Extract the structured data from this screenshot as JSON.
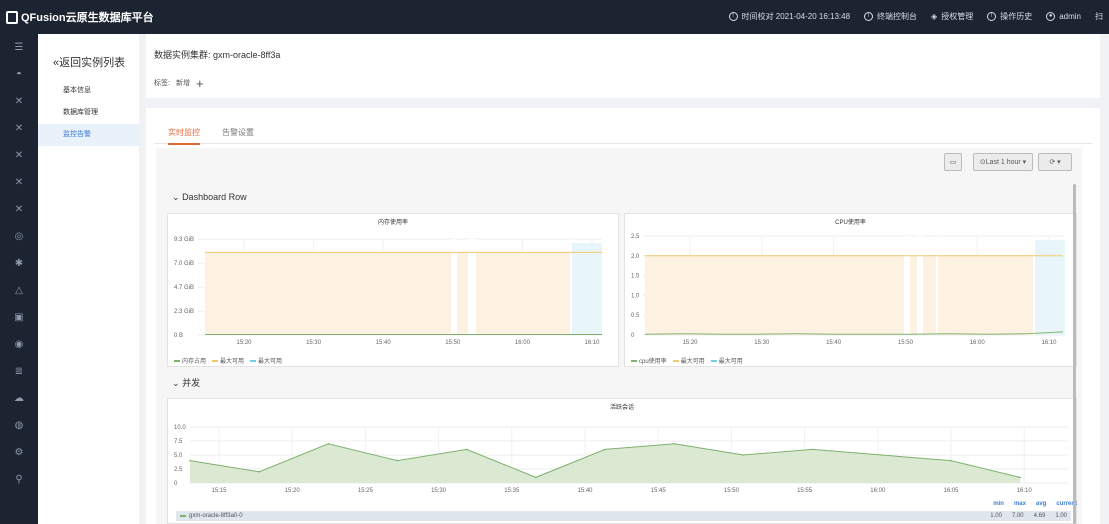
{
  "topbar": {
    "app_name": "QFusion云原生数据库平台",
    "time_check": "时间校对 2021-04-20 16:13:48",
    "terminal": "终端控制台",
    "license": "授权管理",
    "history": "操作历史",
    "user": "admin",
    "extra": "扫"
  },
  "subnav": {
    "back": "«返回实例列表",
    "items": [
      "基本信息",
      "数据库管理",
      "监控告警"
    ]
  },
  "header": {
    "title": "数据实例集群: gxm-oracle-8ff3a",
    "tags_label": "标签:",
    "tag_new": "新增",
    "tag_add": "+"
  },
  "tabs": [
    "实时监控",
    "告警设置"
  ],
  "toolbar": {
    "time_range": "Last 1 hour",
    "dropdown": "▾",
    "refresh": "⟳"
  },
  "rows": {
    "dashboard": "Dashboard Row",
    "concurrency": "并发"
  },
  "panels": {
    "mem": {
      "title": "内存使用率",
      "yticks": [
        "9.3 GiB",
        "7.0 GiB",
        "4.7 GiB",
        "2.3 GiB",
        "0 B"
      ],
      "xticks": [
        "15:20",
        "15:30",
        "15:40",
        "15:50",
        "16:00",
        "16:10"
      ],
      "legend": [
        "内存占用",
        "最大可用",
        "最大可用"
      ]
    },
    "cpu": {
      "title": "CPU使用率",
      "yticks": [
        "2.5",
        "2.0",
        "1.5",
        "1.0",
        "0.5",
        "0"
      ],
      "xticks": [
        "15:20",
        "15:30",
        "15:40",
        "15:50",
        "16:00",
        "16:10"
      ],
      "legend": [
        "cpu使用率",
        "最大可用",
        "最大可用"
      ]
    },
    "sessions": {
      "title": "活跃会话",
      "yticks": [
        "10.0",
        "7.5",
        "5.0",
        "2.5",
        "0"
      ],
      "xticks": [
        "15:15",
        "15:20",
        "15:25",
        "15:30",
        "15:35",
        "15:40",
        "15:45",
        "15:50",
        "15:55",
        "16:00",
        "16:05",
        "16:10"
      ],
      "stat_headers": [
        "min",
        "max",
        "avg",
        "current"
      ],
      "series_name": "gxm-oracle-8ff3a0-0",
      "stats": [
        "1.00",
        "7.00",
        "4.69",
        "1.00"
      ]
    }
  },
  "chart_data": [
    {
      "type": "area",
      "title": "内存使用率",
      "x": [
        "15:15",
        "15:20",
        "15:25",
        "15:30",
        "15:35",
        "15:40",
        "15:45",
        "15:50",
        "15:55",
        "16:00",
        "16:05",
        "16:10"
      ],
      "series": [
        {
          "name": "内存占用",
          "values": [
            0.05,
            0.05,
            0.05,
            0.05,
            0.05,
            0.05,
            0.05,
            0.05,
            0.05,
            0.05,
            0.05,
            0.05
          ]
        },
        {
          "name": "最大可用",
          "values": [
            8,
            8,
            8,
            8,
            8,
            8,
            8,
            8,
            8,
            8,
            8,
            8
          ]
        }
      ],
      "ylim": [
        0,
        9.3
      ]
    },
    {
      "type": "area",
      "title": "CPU使用率",
      "x": [
        "15:15",
        "15:20",
        "15:25",
        "15:30",
        "15:35",
        "15:40",
        "15:45",
        "15:50",
        "15:55",
        "16:00",
        "16:05",
        "16:10"
      ],
      "series": [
        {
          "name": "cpu使用率",
          "values": [
            0.02,
            0.03,
            0.02,
            0.02,
            0.03,
            0.02,
            0.02,
            0.02,
            0.03,
            0.02,
            0.03,
            0.08
          ]
        },
        {
          "name": "最大可用",
          "values": [
            2,
            2,
            2,
            2,
            2,
            2,
            2,
            2,
            2,
            2,
            2,
            2
          ]
        }
      ],
      "ylim": [
        0,
        2.5
      ]
    },
    {
      "type": "area",
      "title": "活跃会话",
      "x": [
        "15:13",
        "15:15",
        "15:20",
        "15:25",
        "15:30",
        "15:35",
        "15:40",
        "15:45",
        "15:50",
        "15:55",
        "16:00",
        "16:05",
        "16:10"
      ],
      "series": [
        {
          "name": "gxm-oracle-8ff3a0-0",
          "values": [
            4,
            2,
            7,
            4,
            6,
            1,
            6,
            7,
            5,
            6,
            5,
            4,
            1
          ]
        }
      ],
      "ylim": [
        0,
        10
      ],
      "color": "#7eb26d"
    }
  ],
  "colors": {
    "orange": "#f2c96d",
    "green": "#7eb26d",
    "blue": "#6ed0e0",
    "accent": "#e06a3b",
    "topbar": "#1c2431"
  }
}
